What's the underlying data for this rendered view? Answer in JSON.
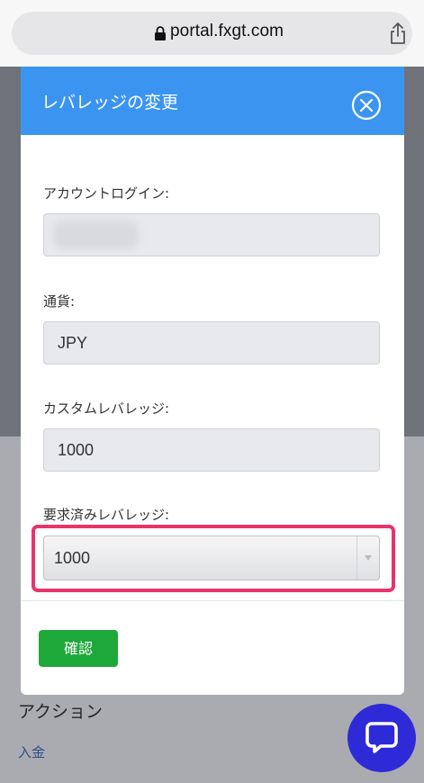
{
  "browser": {
    "url": "portal.fxgt.com"
  },
  "background": {
    "heading": "アクション",
    "link": "入金"
  },
  "modal": {
    "title": "レバレッジの変更",
    "fields": {
      "account_login": {
        "label": "アカウントログイン:",
        "value": ""
      },
      "currency": {
        "label": "通貨:",
        "value": "JPY"
      },
      "custom_leverage": {
        "label": "カスタムレバレッジ:",
        "value": "1000"
      },
      "requested_leverage": {
        "label": "要求済みレバレッジ:",
        "selected": "1000"
      }
    },
    "confirm_label": "確認"
  },
  "colors": {
    "header_blue": "#3b95f0",
    "confirm_green": "#1fa83a",
    "highlight_pink": "#e8336b",
    "chat_blue": "#2f2ad8"
  },
  "icons": {
    "lock": "lock-icon",
    "share": "share-icon",
    "close": "close-circle-icon",
    "chat": "chat-bubble-icon",
    "dropdown": "chevron-down-icon"
  }
}
